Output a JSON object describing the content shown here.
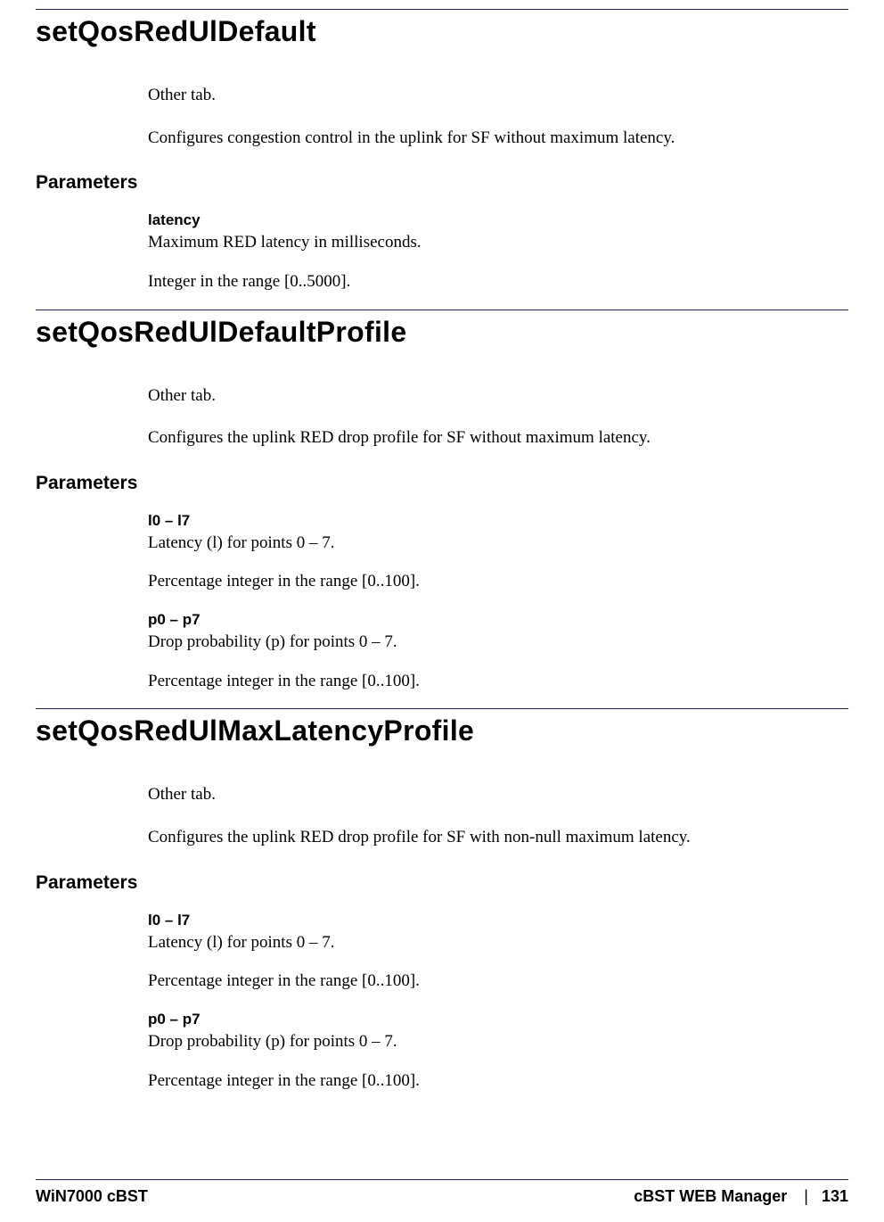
{
  "sections": [
    {
      "title": "setQosRedUlDefault",
      "tab": "Other tab.",
      "desc": "Configures congestion control in the uplink for SF without maximum latency.",
      "paramsHeading": "Parameters",
      "params": [
        {
          "name": "latency",
          "desc": "Maximum RED latency in milliseconds.",
          "range": "Integer in the range [0..5000]."
        }
      ]
    },
    {
      "title": "setQosRedUlDefaultProfile",
      "tab": "Other tab.",
      "desc": "Configures the uplink RED drop profile for SF without maximum latency.",
      "paramsHeading": "Parameters",
      "params": [
        {
          "name": "l0 – l7",
          "desc": "Latency (l) for points 0 – 7.",
          "range": "Percentage integer in the range [0..100]."
        },
        {
          "name": "p0 – p7",
          "desc": "Drop probability (p) for points 0 – 7.",
          "range": "Percentage integer in the range [0..100]."
        }
      ]
    },
    {
      "title": "setQosRedUlMaxLatencyProfile",
      "tab": "Other tab.",
      "desc": "Configures the uplink RED drop profile for SF with non-null maximum latency.",
      "paramsHeading": "Parameters",
      "params": [
        {
          "name": "l0 – l7",
          "desc": "Latency (l) for points 0 – 7.",
          "range": "Percentage integer in the range [0..100]."
        },
        {
          "name": "p0 – p7",
          "desc": "Drop probability (p) for points 0 – 7.",
          "range": "Percentage integer in the range [0..100]."
        }
      ]
    }
  ],
  "footer": {
    "left": "WiN7000 cBST",
    "rightTitle": "cBST WEB Manager",
    "sep": "|",
    "page": "131"
  }
}
